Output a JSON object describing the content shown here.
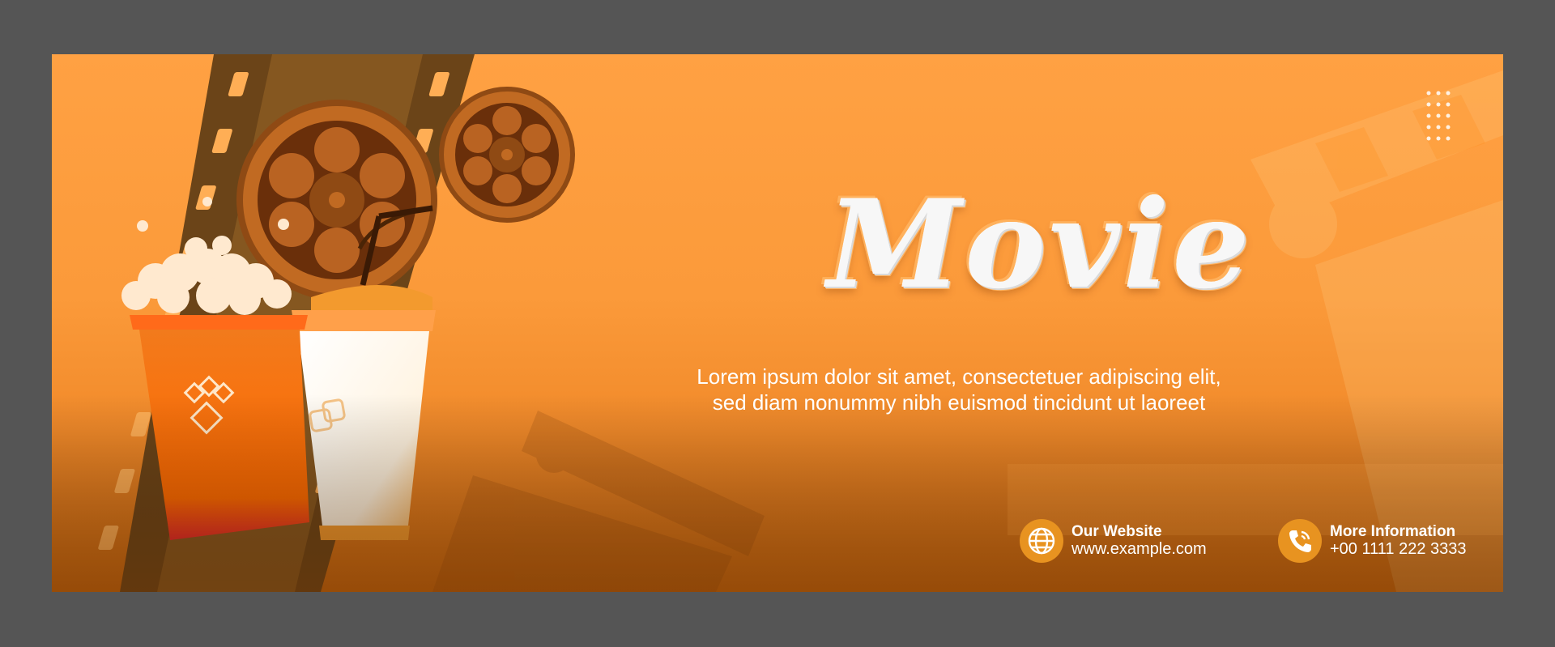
{
  "banner": {
    "title": "Movie",
    "tagline_line1": "Lorem ipsum dolor sit amet, consectetuer adipiscing elit,",
    "tagline_line2": "sed diam nonummy nibh euismod tincidunt ut laoreet",
    "colors": {
      "background": "#ffa143",
      "accent": "#e89320",
      "text": "#ffffff"
    }
  },
  "contacts": {
    "website": {
      "icon": "globe-icon",
      "label": "Our Website",
      "value": "www.example.com"
    },
    "info": {
      "icon": "phone-icon",
      "label": "More Information",
      "value": "+00 1111 222 3333"
    }
  }
}
